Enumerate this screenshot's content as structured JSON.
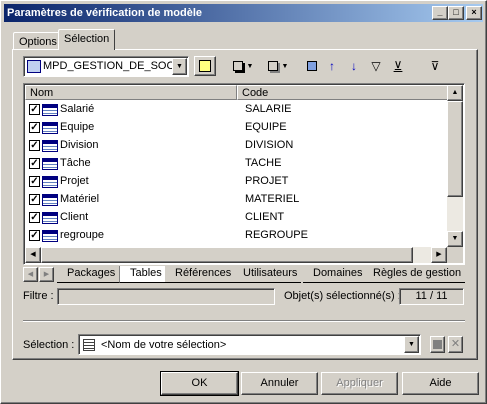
{
  "window": {
    "title": "Paramètres de vérification de modèle"
  },
  "titlebar_buttons": {
    "minimize": "_",
    "maximize": "□",
    "close": "×"
  },
  "tabs": [
    {
      "label": "Options",
      "active": false
    },
    {
      "label": "Sélection",
      "active": true
    }
  ],
  "model_combo": {
    "value": "MPD_GESTION_DE_SOCIE"
  },
  "list": {
    "columns": [
      "Nom",
      "Code"
    ],
    "rows": [
      {
        "name": "Salarié",
        "code": "SALARIE",
        "checked": true
      },
      {
        "name": "Equipe",
        "code": "EQUIPE",
        "checked": true
      },
      {
        "name": "Division",
        "code": "DIVISION",
        "checked": true
      },
      {
        "name": "Tâche",
        "code": "TACHE",
        "checked": true
      },
      {
        "name": "Projet",
        "code": "PROJET",
        "checked": true
      },
      {
        "name": "Matériel",
        "code": "MATERIEL",
        "checked": true
      },
      {
        "name": "Client",
        "code": "CLIENT",
        "checked": true
      },
      {
        "name": "regroupe",
        "code": "REGROUPE",
        "checked": true
      }
    ]
  },
  "bottom_tabs": [
    "Packages",
    "Tables",
    "Références",
    "Utilisateurs",
    "Domaines",
    "Règles de gestion"
  ],
  "bottom_tabs_active": "Tables",
  "filter": {
    "label": "Filtre :",
    "value": ""
  },
  "selected_count": {
    "label": "Objet(s) sélectionné(s) :",
    "value": "11 / 11"
  },
  "selection": {
    "label": "Sélection :",
    "value": "<Nom de votre sélection>"
  },
  "buttons": {
    "ok": "OK",
    "cancel": "Annuler",
    "apply": "Appliquer",
    "help": "Aide"
  },
  "colors": {
    "titlebar_start": "#0a246a",
    "titlebar_end": "#a6caf0",
    "face": "#d4d0c8"
  }
}
